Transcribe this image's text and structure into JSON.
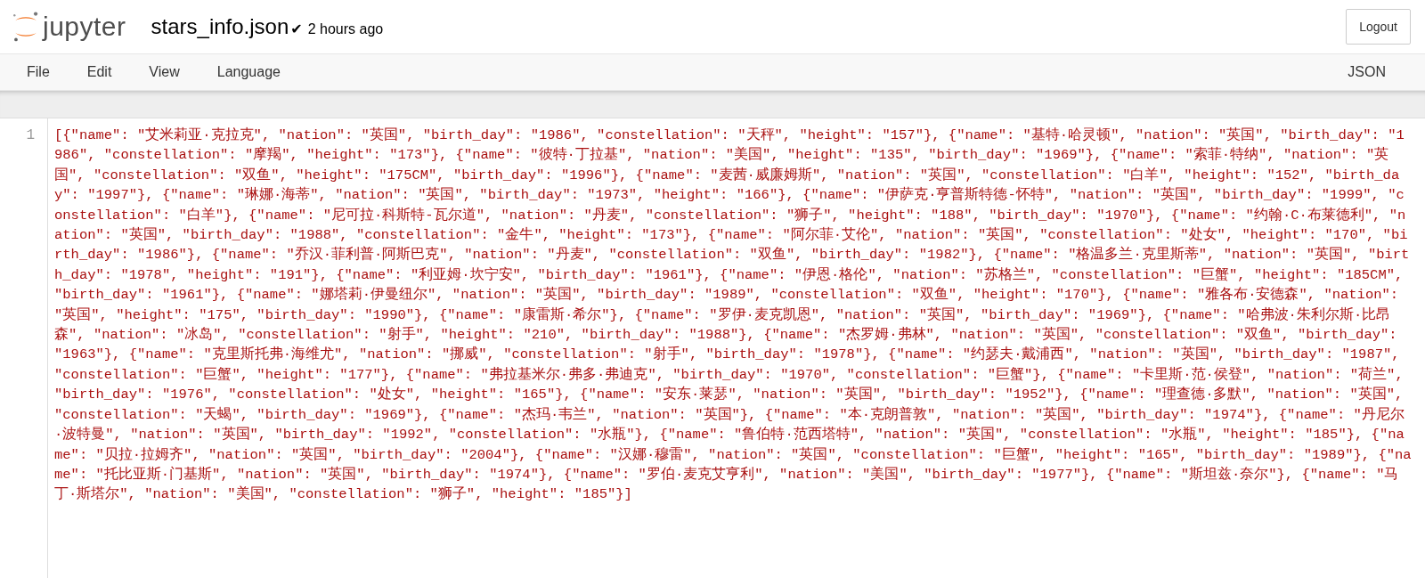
{
  "header": {
    "logo_text": "jupyter",
    "filename": "stars_info.json",
    "save_mark": "✔",
    "last_saved": "2 hours ago",
    "logout_button": "Logout"
  },
  "menu": {
    "items": [
      "File",
      "Edit",
      "View",
      "Language"
    ],
    "mode": "JSON"
  },
  "editor": {
    "lines": [
      {
        "number": "1",
        "text": "[{\"name\": \"艾米莉亚·克拉克\", \"nation\": \"英国\", \"birth_day\": \"1986\", \"constellation\": \"天秤\", \"height\": \"157\"}, {\"name\": \"基特·哈灵顿\", \"nation\": \"英国\", \"birth_day\": \"1986\", \"constellation\": \"摩羯\", \"height\": \"173\"}, {\"name\": \"彼特·丁拉基\", \"nation\": \"美国\", \"height\": \"135\", \"birth_day\": \"1969\"}, {\"name\": \"索菲·特纳\", \"nation\": \"英国\", \"constellation\": \"双鱼\", \"height\": \"175CM\", \"birth_day\": \"1996\"}, {\"name\": \"麦茜·威廉姆斯\", \"nation\": \"英国\", \"constellation\": \"白羊\", \"height\": \"152\", \"birth_day\": \"1997\"}, {\"name\": \"琳娜·海蒂\", \"nation\": \"英国\", \"birth_day\": \"1973\", \"height\": \"166\"}, {\"name\": \"伊萨克·亨普斯特德-怀特\", \"nation\": \"英国\", \"birth_day\": \"1999\", \"constellation\": \"白羊\"}, {\"name\": \"尼可拉·科斯特-瓦尔道\", \"nation\": \"丹麦\", \"constellation\": \"狮子\", \"height\": \"188\", \"birth_day\": \"1970\"}, {\"name\": \"约翰·C·布莱德利\", \"nation\": \"英国\", \"birth_day\": \"1988\", \"constellation\": \"金牛\", \"height\": \"173\"}, {\"name\": \"阿尔菲·艾伦\", \"nation\": \"英国\", \"constellation\": \"处女\", \"height\": \"170\", \"birth_day\": \"1986\"}, {\"name\": \"乔汉·菲利普·阿斯巴克\", \"nation\": \"丹麦\", \"constellation\": \"双鱼\", \"birth_day\": \"1982\"}, {\"name\": \"格温多兰·克里斯蒂\", \"nation\": \"英国\", \"birth_day\": \"1978\", \"height\": \"191\"}, {\"name\": \"利亚姆·坎宁安\", \"birth_day\": \"1961\"}, {\"name\": \"伊恩·格伦\", \"nation\": \"苏格兰\", \"constellation\": \"巨蟹\", \"height\": \"185CM\", \"birth_day\": \"1961\"}, {\"name\": \"娜塔莉·伊曼纽尔\", \"nation\": \"英国\", \"birth_day\": \"1989\", \"constellation\": \"双鱼\", \"height\": \"170\"}, {\"name\": \"雅各布·安德森\", \"nation\": \"英国\", \"height\": \"175\", \"birth_day\": \"1990\"}, {\"name\": \"康雷斯·希尔\"}, {\"name\": \"罗伊·麦克凯恩\", \"nation\": \"英国\", \"birth_day\": \"1969\"}, {\"name\": \"哈弗波·朱利尔斯·比昂森\", \"nation\": \"冰岛\", \"constellation\": \"射手\", \"height\": \"210\", \"birth_day\": \"1988\"}, {\"name\": \"杰罗姆·弗林\", \"nation\": \"英国\", \"constellation\": \"双鱼\", \"birth_day\": \"1963\"}, {\"name\": \"克里斯托弗·海维尤\", \"nation\": \"挪威\", \"constellation\": \"射手\", \"birth_day\": \"1978\"}, {\"name\": \"约瑟夫·戴浦西\", \"nation\": \"英国\", \"birth_day\": \"1987\", \"constellation\": \"巨蟹\", \"height\": \"177\"}, {\"name\": \"弗拉基米尔·弗多·弗迪克\", \"birth_day\": \"1970\", \"constellation\": \"巨蟹\"}, {\"name\": \"卡里斯·范·侯登\", \"nation\": \"荷兰\", \"birth_day\": \"1976\", \"constellation\": \"处女\", \"height\": \"165\"}, {\"name\": \"安东·莱瑟\", \"nation\": \"英国\", \"birth_day\": \"1952\"}, {\"name\": \"理查德·多默\", \"nation\": \"英国\", \"constellation\": \"天蝎\", \"birth_day\": \"1969\"}, {\"name\": \"杰玛·韦兰\", \"nation\": \"英国\"}, {\"name\": \"本·克朗普敦\", \"nation\": \"英国\", \"birth_day\": \"1974\"}, {\"name\": \"丹尼尔·波特曼\", \"nation\": \"英国\", \"birth_day\": \"1992\", \"constellation\": \"水瓶\"}, {\"name\": \"鲁伯特·范西塔特\", \"nation\": \"英国\", \"constellation\": \"水瓶\", \"height\": \"185\"}, {\"name\": \"贝拉·拉姆齐\", \"nation\": \"英国\", \"birth_day\": \"2004\"}, {\"name\": \"汉娜·穆雷\", \"nation\": \"英国\", \"constellation\": \"巨蟹\", \"height\": \"165\", \"birth_day\": \"1989\"}, {\"name\": \"托比亚斯·门基斯\", \"nation\": \"英国\", \"birth_day\": \"1974\"}, {\"name\": \"罗伯·麦克艾亨利\", \"nation\": \"美国\", \"birth_day\": \"1977\"}, {\"name\": \"斯坦兹·奈尔\"}, {\"name\": \"马丁·斯塔尔\", \"nation\": \"美国\", \"constellation\": \"狮子\", \"height\": \"185\"}]"
      }
    ]
  }
}
